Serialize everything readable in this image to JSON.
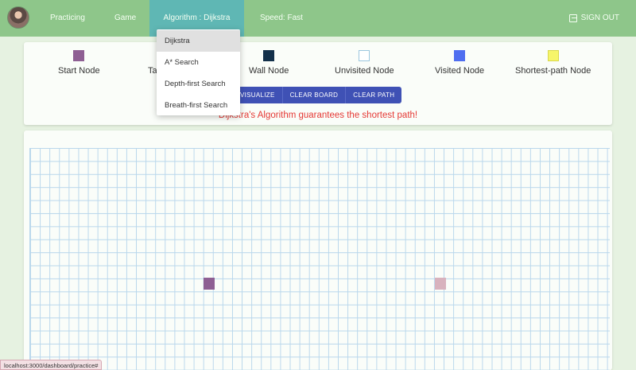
{
  "nav": {
    "items": [
      "Practicing",
      "Game",
      "Algorithm : Dijkstra",
      "Speed: Fast"
    ],
    "signout_label": "SIGN OUT"
  },
  "legend": [
    {
      "label": "Start Node",
      "color": "#8e5f93"
    },
    {
      "label": "Target Node",
      "color": "#d8a0b0"
    },
    {
      "label": "Wall Node",
      "color": "#13304a"
    },
    {
      "label": "Unvisited Node",
      "color": "#ffffff"
    },
    {
      "label": "Visited Node",
      "color": "#4f6ef0"
    },
    {
      "label": "Shortest-path Node",
      "color": "#f6f56a"
    }
  ],
  "controls": {
    "visualize_label": "VISUALIZE",
    "clear_board_label": "CLEAR BOARD",
    "clear_path_label": "CLEAR PATH"
  },
  "algorithm_message": "Dijkstra's Algorithm guarantees the shortest path!",
  "dropdown": {
    "items": [
      "Dijkstra",
      "A* Search",
      "Depth-first Search",
      "Breath-first Search"
    ],
    "selected": "Dijkstra"
  },
  "grid": {
    "start_node_color": "#8e5f93",
    "target_node_color": "#d8b2bd"
  },
  "status_url": "localhost:3000/dashboard/practice#"
}
